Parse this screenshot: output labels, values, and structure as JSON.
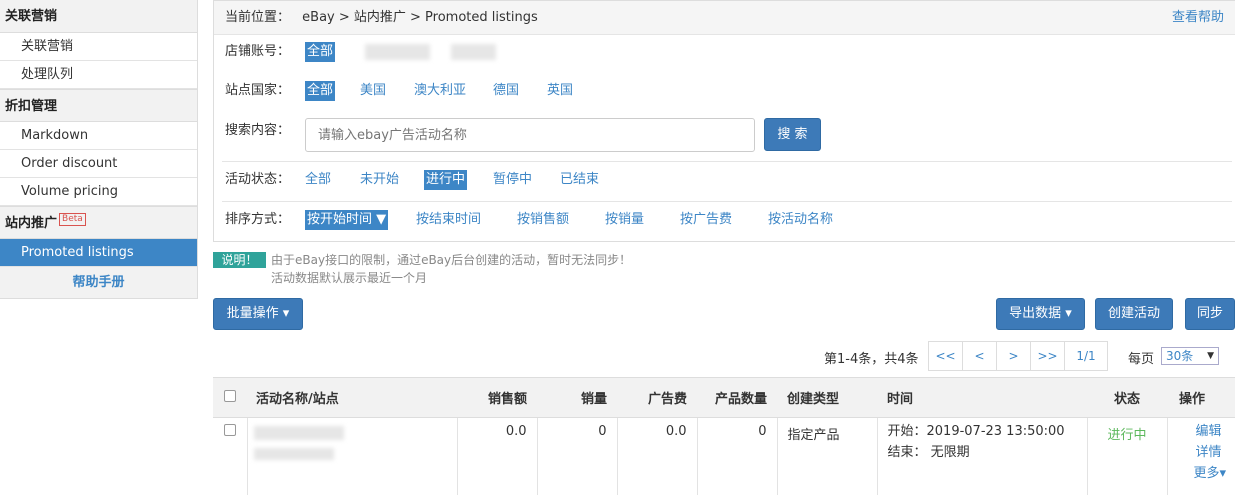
{
  "sidebar": {
    "section1": "关联营销",
    "s1_items": [
      "关联营销",
      "处理队列"
    ],
    "section2": "折扣管理",
    "s2_items": [
      "Markdown",
      "Order discount",
      "Volume pricing"
    ],
    "section3": "站内推广",
    "beta": "Beta",
    "s3_items": [
      "Promoted listings"
    ],
    "help": "帮助手册"
  },
  "breadcrumb": {
    "label": "当前位置：",
    "path": "eBay > 站内推广 > Promoted listings",
    "help": "查看帮助"
  },
  "filters": {
    "store_label": "店铺账号：",
    "store_all": "全部",
    "country_label": "站点国家：",
    "countries": [
      "全部",
      "美国",
      "澳大利亚",
      "德国",
      "英国"
    ],
    "search_label": "搜索内容：",
    "search_placeholder": "请输入ebay广告活动名称",
    "search_button": "搜 索",
    "status_label": "活动状态：",
    "statuses": [
      "全部",
      "未开始",
      "进行中",
      "暂停中",
      "已结束"
    ],
    "sort_label": "排序方式：",
    "sorts": [
      "按开始时间 ▼",
      "按结束时间",
      "按销售额",
      "按销量",
      "按广告费",
      "按活动名称"
    ]
  },
  "notice": {
    "tag": "说明！",
    "line1": "由于eBay接口的限制，通过eBay后台创建的活动，暂时无法同步！",
    "line2": "活动数据默认展示最近一个月"
  },
  "toolbar": {
    "batch": "批量操作 ▾",
    "export": "导出数据 ▾",
    "create": "创建活动",
    "sync": "同步"
  },
  "pager": {
    "summary": "第1-4条，共4条",
    "buttons": [
      "<<",
      "<",
      ">",
      ">>",
      "1/1"
    ],
    "per_page_label": "每页",
    "per_page": "30条"
  },
  "table": {
    "headers": [
      "活动名称/站点",
      "销售额",
      "销量",
      "广告费",
      "产品数量",
      "创建类型",
      "时间",
      "状态",
      "操作"
    ],
    "row": {
      "sales": "0.0",
      "qty": "0",
      "ad_fee": "0.0",
      "products": "0",
      "type": "指定产品",
      "start": "开始：2019-07-23 13:50:00",
      "end": "结束：  无限期",
      "status": "进行中",
      "actions": [
        "编辑",
        "详情",
        "更多▾"
      ]
    }
  },
  "colors": {
    "accent": "#3d86c6",
    "status_running": "#5cb85c",
    "notice": "#2fa39a"
  }
}
